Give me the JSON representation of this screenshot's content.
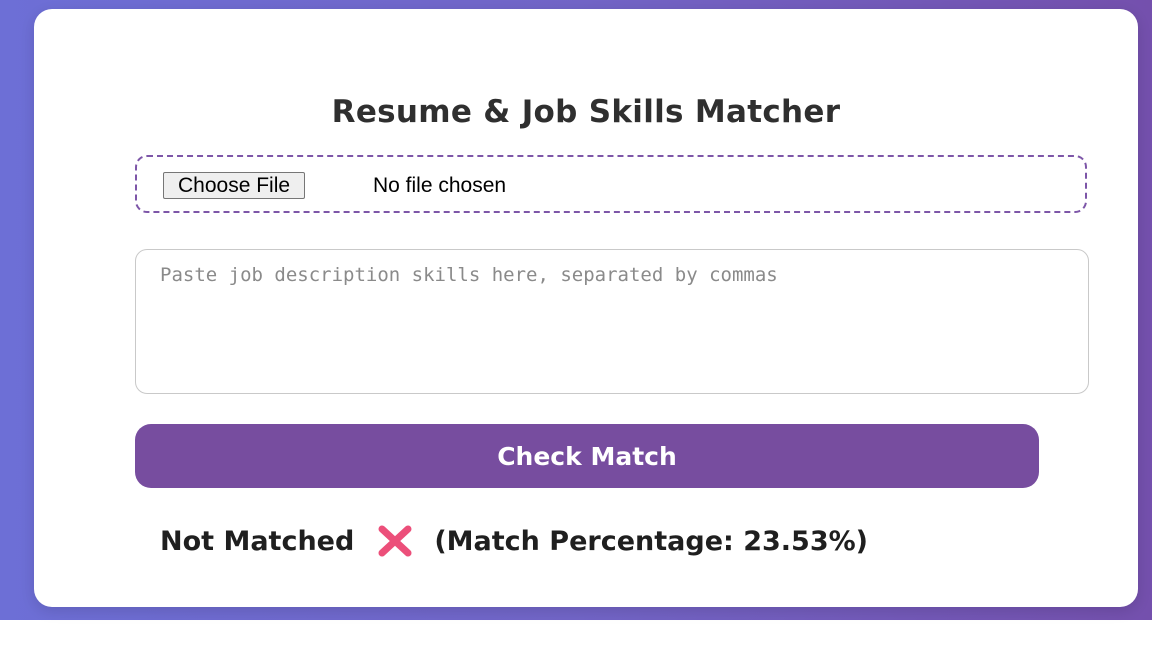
{
  "page": {
    "title": "Resume & Job Skills Matcher"
  },
  "upload": {
    "button_label": "Choose File",
    "status": "No file chosen"
  },
  "skills_input": {
    "placeholder": "Paste job description skills here, separated by commas",
    "value": ""
  },
  "actions": {
    "check_label": "Check Match"
  },
  "result": {
    "status": "Not Matched",
    "icon": "cross-mark-icon",
    "percentage_text": "(Match Percentage: 23.53%)",
    "match_percentage": 23.53
  },
  "colors": {
    "accent": "#774d9f",
    "upload_border": "#7d56a8",
    "cross_icon": "#ec4f7a",
    "background_gradient_start": "#6d6fd6",
    "background_gradient_end": "#7450ad"
  }
}
